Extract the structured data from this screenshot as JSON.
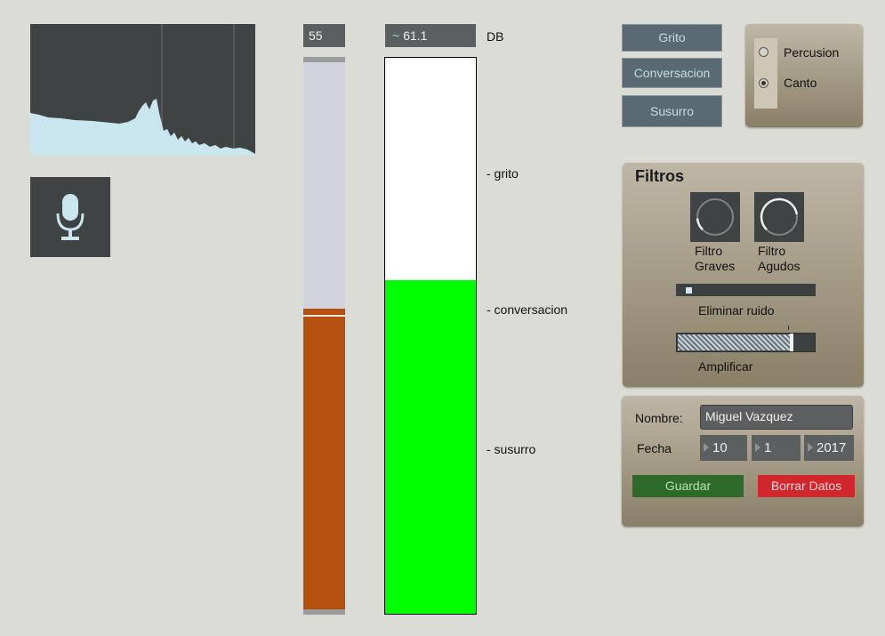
{
  "level": {
    "value": "55",
    "fill_fraction": 0.55
  },
  "meter": {
    "value": "61.1",
    "unit": "DB",
    "fill_fraction": 0.6
  },
  "marks": {
    "grito": "- grito",
    "conversacion": "- conversacion",
    "susurro": "- susurro"
  },
  "presets": {
    "grito": "Grito",
    "conversacion": "Conversacion",
    "susurro": "Susurro"
  },
  "mode": {
    "options": [
      {
        "label": "Percusion",
        "selected": false
      },
      {
        "label": "Canto",
        "selected": true
      }
    ]
  },
  "filters": {
    "title": "Filtros",
    "graves": {
      "label_line1": "Filtro",
      "label_line2": "Graves",
      "value": 0.15
    },
    "agudos": {
      "label_line1": "Filtro",
      "label_line2": "Agudos",
      "value": 0.8
    },
    "noise": {
      "label": "Eliminar ruido",
      "value": 0.05
    },
    "amplify": {
      "label": "Amplificar",
      "value": 0.82
    }
  },
  "form": {
    "name_label": "Nombre:",
    "name_value": "Miguel Vazquez",
    "date_label": "Fecha",
    "day": "10",
    "month": "1",
    "year": "2017",
    "save_label": "Guardar",
    "clear_label": "Borrar Datos"
  },
  "colors": {
    "level_fill": "#b5500f",
    "meter_fill": "#00ff00",
    "save": "#2e6a2a",
    "clear": "#d0262c",
    "spectrum": "#c9e6ee"
  },
  "icons": {
    "mic": "microphone-icon"
  }
}
